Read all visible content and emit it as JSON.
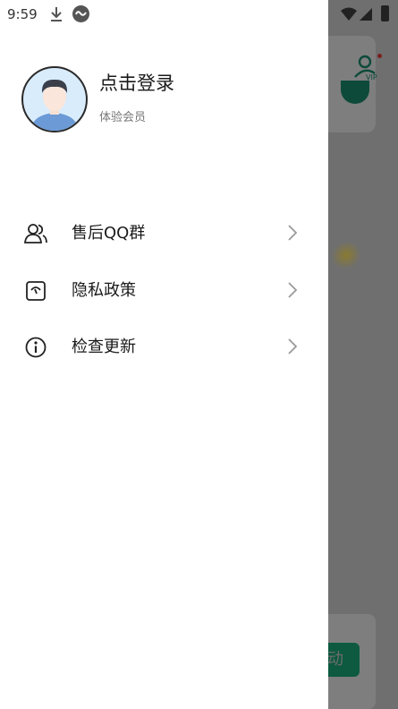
{
  "status_bar": {
    "time": "9:59"
  },
  "profile": {
    "login_text": "点击登录",
    "member_level": "体验会员"
  },
  "menu": {
    "items": [
      {
        "label": "售后QQ群",
        "icon": "users-icon"
      },
      {
        "label": "隐私政策",
        "icon": "policy-icon"
      },
      {
        "label": "检查更新",
        "icon": "info-icon"
      }
    ]
  },
  "background": {
    "vip_label": "VIP",
    "action_button_label": "动"
  },
  "colors": {
    "accent_green": "#0d5a40",
    "drawer_bg": "#ffffff",
    "scrim": "#6f6f6f"
  }
}
